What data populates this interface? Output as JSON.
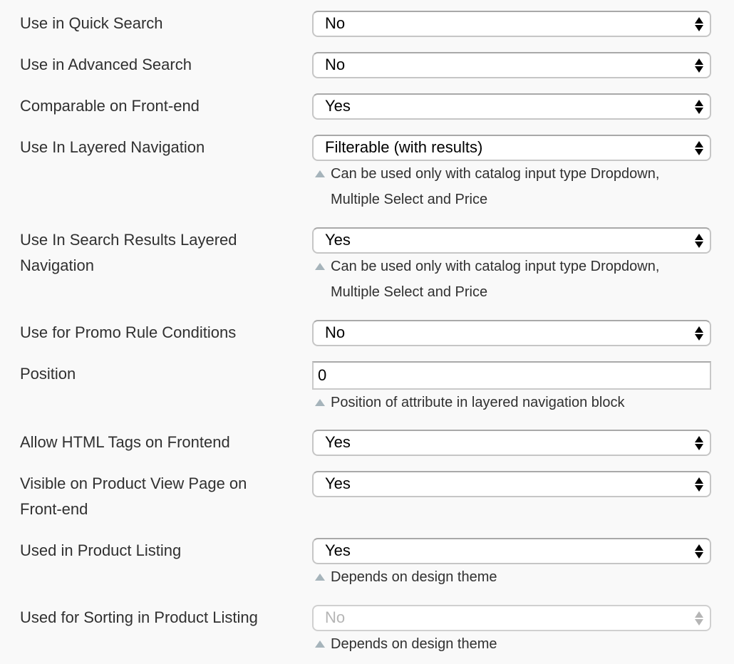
{
  "fields": [
    {
      "id": "quick-search",
      "label": "Use in Quick Search",
      "type": "select",
      "value": "No"
    },
    {
      "id": "advanced-search",
      "label": "Use in Advanced Search",
      "type": "select",
      "value": "No"
    },
    {
      "id": "comparable",
      "label": "Comparable on Front-end",
      "type": "select",
      "value": "Yes"
    },
    {
      "id": "layered-navigation",
      "label": "Use In Layered Navigation",
      "type": "select",
      "value": "Filterable (with results)",
      "note": "Can be used only with catalog input type Dropdown, Multiple Select and Price"
    },
    {
      "id": "search-results-layered-navigation",
      "label": "Use In Search Results Layered Navigation",
      "type": "select",
      "value": "Yes",
      "note": "Can be used only with catalog input type Dropdown, Multiple Select and Price"
    },
    {
      "id": "promo-rule-conditions",
      "label": "Use for Promo Rule Conditions",
      "type": "select",
      "value": "No"
    },
    {
      "id": "position",
      "label": "Position",
      "type": "text",
      "value": "0",
      "note": "Position of attribute in layered navigation block"
    },
    {
      "id": "html-tags-frontend",
      "label": "Allow HTML Tags on Frontend",
      "type": "select",
      "value": "Yes"
    },
    {
      "id": "visible-product-view",
      "label": "Visible on Product View Page on Front-end",
      "type": "select",
      "value": "Yes"
    },
    {
      "id": "product-listing",
      "label": "Used in Product Listing",
      "type": "select",
      "value": "Yes",
      "note": "Depends on design theme"
    },
    {
      "id": "sorting-product-listing",
      "label": "Used for Sorting in Product Listing",
      "type": "select",
      "value": "No",
      "disabled": true,
      "note": "Depends on design theme"
    }
  ]
}
